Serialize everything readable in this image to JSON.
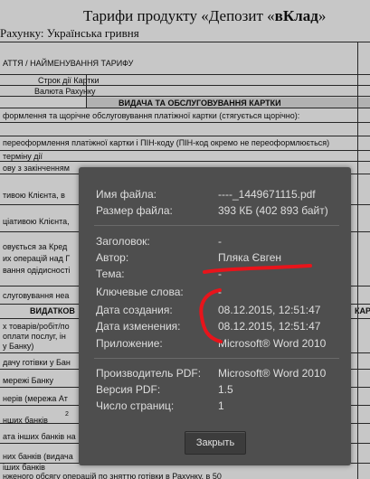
{
  "document": {
    "title_prefix": "Тарифи продукту «Депозит «",
    "title_bold": "вКлад",
    "title_suffix": "»",
    "subtitle": "Рахунку: Українська гривня",
    "cells": [
      "АТТЯ / НАЙМЕНУВАННЯ ТАРИФУ",
      "Строк дії Картки",
      "Валюта Рахунку",
      "ВИДАЧА ТА ОБСЛУГОВУВАННЯ КАРТКИ",
      "формлення  та щорічне обслуговування платіжної картки (стягується щорічно):",
      "переоформлення платіжної картки і ПІН-коду (ПІН-код окремо не переоформлюється)",
      "терміну дії",
      "ову з закінченням",
      "тивою Клієнта, в",
      "ціативою Клієнта,",
      "овується за Кред",
      "их операцій над Г",
      "вання одідисності",
      "слуговування неа",
      "ВИДАТКОВ",
      "КАРТК",
      "х товарів/робіт/по",
      "оплати послуг, ін",
      "у Банку)",
      "дачу готівки у Бан",
      "мережі Банку",
      "нерів (мережа Ат",
      "нших банків",
      "ата інших банків на",
      "них банків (видача",
      "іших банків",
      "нженого обсягу операцій по зняттю готівки в Рахунку, в 50"
    ],
    "footnote_mark": "2"
  },
  "dialog": {
    "rows": [
      {
        "label": "Имя файла:",
        "value": "----_1449671115.pdf"
      },
      {
        "label": "Размер файла:",
        "value": "393 КБ (402 893 байт)"
      },
      {
        "label": "Заголовок:",
        "value": "-"
      },
      {
        "label": "Автор:",
        "value": "Пляка Євген"
      },
      {
        "label": "Тема:",
        "value": "-"
      },
      {
        "label": "Ключевые слова:",
        "value": "-"
      },
      {
        "label": "Дата создания:",
        "value": "08.12.2015, 12:51:47"
      },
      {
        "label": "Дата изменения:",
        "value": "08.12.2015, 12:51:47"
      },
      {
        "label": "Приложение:",
        "value": "Microsoft® Word 2010"
      },
      {
        "label": "Производитель PDF:",
        "value": "Microsoft® Word 2010"
      },
      {
        "label": "Версия PDF:",
        "value": "1.5"
      },
      {
        "label": "Число страниц:",
        "value": "1"
      }
    ],
    "close_label": "Закрыть",
    "background_color": "#4e4e4e",
    "annotation_color": "#e8141b"
  }
}
